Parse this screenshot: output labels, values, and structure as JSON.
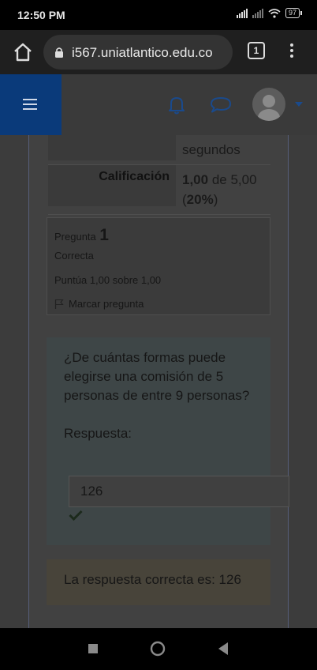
{
  "status_bar": {
    "time": "12:50 PM",
    "battery": "97"
  },
  "browser": {
    "url": "i567.uniatlantico.edu.co",
    "tab_count": "1"
  },
  "summary": {
    "rows": [
      {
        "label": "",
        "value_main": "segundos",
        "value_rest": ""
      },
      {
        "label": "Calificación",
        "value_bold": "1,00",
        "value_rest": " de 5,00",
        "value_line2_bold": "20%",
        "value_line2_pre": "(",
        "value_line2_post": ")"
      }
    ]
  },
  "question_info": {
    "label": "Pregunta",
    "number": "1",
    "state": "Correcta",
    "grade": "Puntúa 1,00 sobre 1,00",
    "flag": "Marcar pregunta"
  },
  "question": {
    "text": "¿De cuántas formas puede elegirse una comisión de 5 personas de entre 9 personas?",
    "answer_label": "Respuesta:",
    "answer_value": "126"
  },
  "feedback": {
    "text": "La respuesta correcta es: 126"
  },
  "colors": {
    "header_menu": "#0a3a7a",
    "accent": "#1a4a8c"
  }
}
